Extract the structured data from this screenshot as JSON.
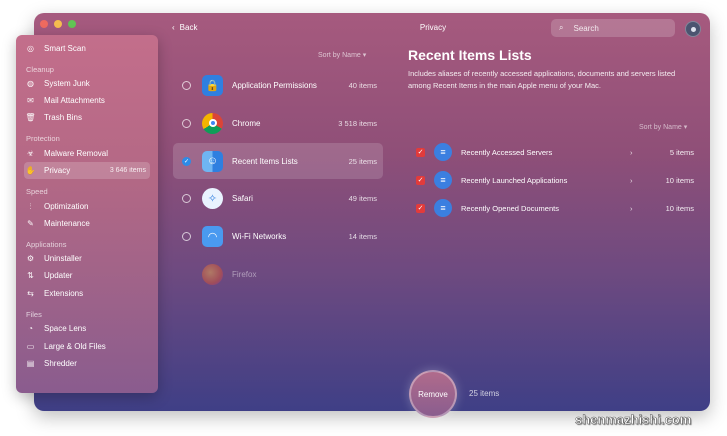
{
  "topbar": {
    "back_label": "Back",
    "title": "Privacy",
    "search_placeholder": "Search"
  },
  "sidebar": {
    "items": [
      {
        "label": "Smart Scan",
        "icon": "scan-icon"
      },
      {
        "label": "System Junk",
        "icon": "junk-icon"
      },
      {
        "label": "Mail Attachments",
        "icon": "mail-icon"
      },
      {
        "label": "Trash Bins",
        "icon": "trash-icon"
      },
      {
        "label": "Malware Removal",
        "icon": "biohazard-icon"
      },
      {
        "label": "Privacy",
        "icon": "hand-icon",
        "count": "3 646 items"
      },
      {
        "label": "Optimization",
        "icon": "sliders-icon"
      },
      {
        "label": "Maintenance",
        "icon": "wrench-icon"
      },
      {
        "label": "Uninstaller",
        "icon": "uninstaller-icon"
      },
      {
        "label": "Updater",
        "icon": "updater-icon"
      },
      {
        "label": "Extensions",
        "icon": "extensions-icon"
      },
      {
        "label": "Space Lens",
        "icon": "lens-icon"
      },
      {
        "label": "Large & Old Files",
        "icon": "folder-icon"
      },
      {
        "label": "Shredder",
        "icon": "shredder-icon"
      }
    ],
    "sections": [
      "Cleanup",
      "Protection",
      "Speed",
      "Applications",
      "Files"
    ]
  },
  "middle": {
    "sort_label": "Sort by Name ▾",
    "rows": [
      {
        "name": "Application Permissions",
        "items": "40 items"
      },
      {
        "name": "Chrome",
        "items": "3 518 items"
      },
      {
        "name": "Recent Items Lists",
        "items": "25 items"
      },
      {
        "name": "Safari",
        "items": "49 items"
      },
      {
        "name": "Wi-Fi Networks",
        "items": "14 items"
      },
      {
        "name": "Firefox",
        "items": ""
      }
    ]
  },
  "detail": {
    "title": "Recent Items Lists",
    "description": "Includes aliases of recently accessed applications, documents and servers listed among Recent Items in the main Apple menu of your Mac.",
    "sort_label": "Sort by Name ▾",
    "rows": [
      {
        "label": "Recently Accessed Servers",
        "items": "5 items"
      },
      {
        "label": "Recently Launched Applications",
        "items": "10 items"
      },
      {
        "label": "Recently Opened Documents",
        "items": "10 items"
      }
    ]
  },
  "footer": {
    "remove_label": "Remove",
    "count": "25 items"
  },
  "watermark": "shenmazhishi.com",
  "colors": {
    "accent_blue": "#2e8be6",
    "check_red": "#e23b3b"
  }
}
